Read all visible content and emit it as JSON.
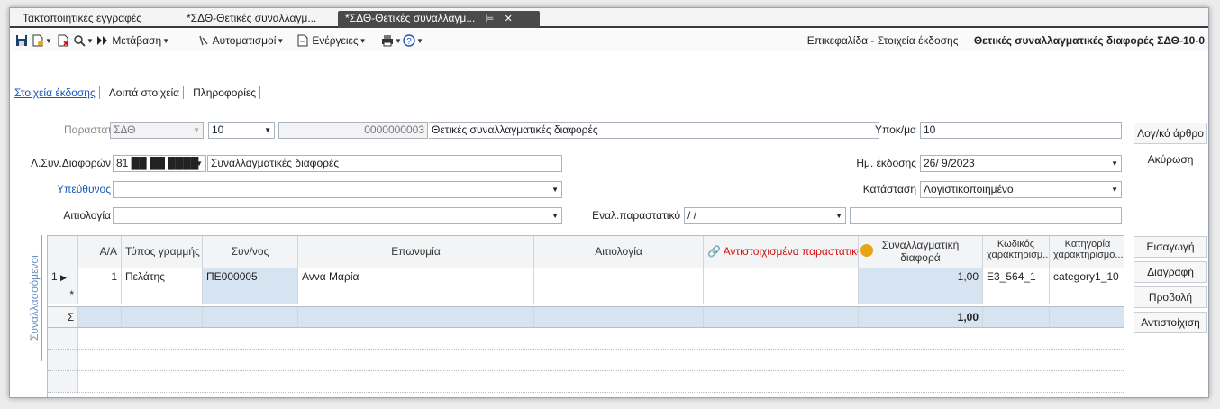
{
  "tabs": [
    {
      "label": "Τακτοποιητικές εγγραφές"
    },
    {
      "label": "*ΣΔΘ-Θετικές συναλλαγμ..."
    },
    {
      "label": "*ΣΔΘ-Θετικές συναλλαγμ...",
      "pin": "⊨",
      "close": "✕"
    }
  ],
  "toolbar": {
    "goto": "Μετάβαση",
    "automations": "Αυτοματισμοί",
    "actions": "Ενέργειες",
    "header_label": "Επικεφαλίδα - Στοιχεία έκδοσης",
    "header_title": "Θετικές συναλλαγματικές διαφορές ΣΔΘ-10-0"
  },
  "subtabs": [
    "Στοιχεία έκδοσης",
    "Λοιπά στοιχεία",
    "Πληροφορίες"
  ],
  "form": {
    "doc_label": "Παραστατικό",
    "doc_value": "ΣΔΘ",
    "series_value": "10",
    "number_value": "0000000003",
    "doc_desc": "Θετικές συναλλαγματικές διαφορές",
    "branch_label": "Υποκ/μα",
    "branch_value": "10",
    "account_label": "Λ.Συν.Διαφορών",
    "account_value": "81 ██ ██ ████",
    "account_desc": "Συναλλαγματικές διαφορές",
    "date_label": "Ημ. έκδοσης",
    "date_value": "26/ 9/2023",
    "responsible_label": "Υπεύθυνος",
    "status_label": "Κατάσταση",
    "status_value": "Λογιστικοποιημένο",
    "reason_label": "Αιτιολογία",
    "alt_doc_label": "Εναλ.παραστατικό",
    "alt_doc_value": "  /  /"
  },
  "buttons": {
    "journal": "Λογ/κό άρθρο",
    "cancel": "Ακύρωση",
    "insert": "Εισαγωγή",
    "delete": "Διαγραφή",
    "view": "Προβολή",
    "match": "Αντιστοίχιση"
  },
  "grid": {
    "side_tab": "Συναλλασσόμενοι",
    "headers": {
      "aa": "Α/Α",
      "line_type": "Τύπος γραμμής",
      "partner": "Συν/νος",
      "name": "Επωνυμία",
      "reason": "Αιτιολογία",
      "matched": "Αντιστοιχισμένα παραστατικά",
      "fx_diff_1": "Συναλλαγματική",
      "fx_diff_2": "διαφορά",
      "code_1": "Κωδικός",
      "code_2": "χαρακτηρισμ...",
      "cat_1": "Κατηγορία",
      "cat_2": "χαρακτηρισμο..."
    },
    "rows": [
      {
        "num": "1",
        "aa": "1",
        "line_type": "Πελάτης",
        "partner": "ΠΕ000005",
        "name": "Αννα Μαρία",
        "fx_diff": "1,00",
        "code": "E3_564_1",
        "category": "category1_10"
      }
    ],
    "new_row_marker": "*",
    "sum_marker": "Σ",
    "sum_value": "1,00"
  }
}
